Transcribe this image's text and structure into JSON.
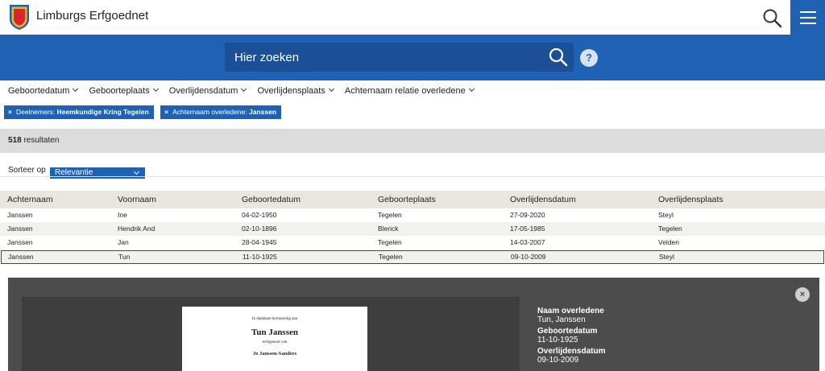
{
  "header": {
    "brand": "Limburgs Erfgoednet",
    "search_icon": "search-icon",
    "menu_icon": "hamburger-icon",
    "colors": {
      "primary": "#1f62b4",
      "logo_red": "#d8242c",
      "logo_blue": "#1f62b4",
      "logo_gold": "#f2b41d"
    }
  },
  "search": {
    "placeholder": "Hier zoeken",
    "help_label": "?"
  },
  "filters": [
    "Geboortedatum",
    "Geboorteplaats",
    "Overlijdensdatum",
    "Overlijdensplaats",
    "Achternaam relatie overledene"
  ],
  "active_filters": [
    {
      "remove": "×",
      "label": "Deelnemers:",
      "value": "Heemkundige Kring Tegelen"
    },
    {
      "remove": "×",
      "label": "Achternaam overledene:",
      "value": "Janssen"
    }
  ],
  "results": {
    "count": "518",
    "label": "resultaten"
  },
  "sort": {
    "label": "Sorteer op",
    "selected": "Relevantie"
  },
  "table": {
    "headers": [
      "Achternaam",
      "Voornaam",
      "Geboortedatum",
      "Geboorteplaats",
      "Overlijdensdatum",
      "Overlijdensplaats"
    ],
    "rows": [
      [
        "Janssen",
        "Ine",
        "04-02-1950",
        "Tegelen",
        "27-09-2020",
        "Steyl"
      ],
      [
        "Janssen",
        "Hendrik And",
        "02-10-1896",
        "Blerick",
        "17-05-1985",
        "Tegelen"
      ],
      [
        "Janssen",
        "Jan",
        "28-04-1945",
        "Tegelen",
        "14-03-2007",
        "Velden"
      ],
      [
        "Janssen",
        "Tun",
        "11-10-1925",
        "Tegelen",
        "09-10-2009",
        "Steyl"
      ]
    ],
    "selected_row": 3
  },
  "detail": {
    "card": {
      "line1": "In dankbare herinnering aan",
      "name": "Tun Janssen",
      "line3": "echtgenoot van",
      "spouse": "Jo Janssen-Sanders"
    },
    "fields": [
      {
        "label": "Naam overledene",
        "value": "Tun, Janssen"
      },
      {
        "label": "Geboortedatum",
        "value": "11-10-1925"
      },
      {
        "label": "Overlijdensdatum",
        "value": "09-10-2009"
      }
    ],
    "close_label": "×"
  }
}
